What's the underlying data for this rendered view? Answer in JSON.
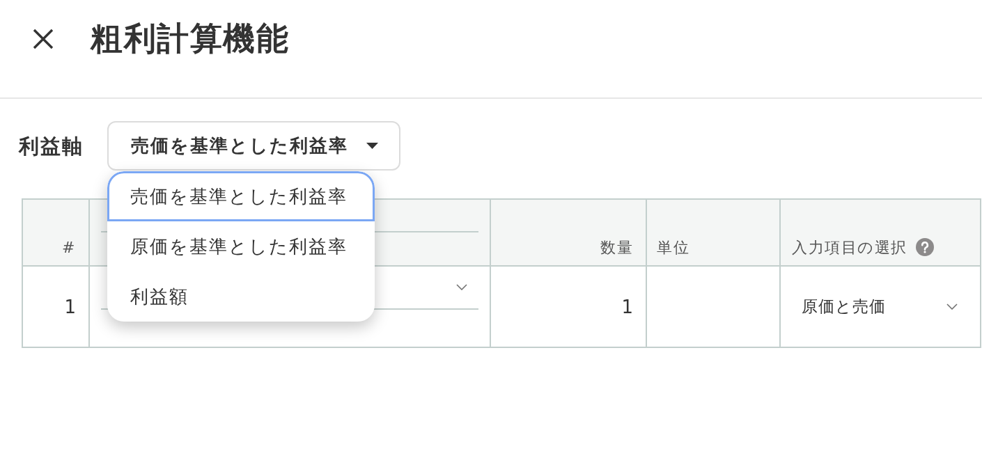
{
  "header": {
    "title": "粗利計算機能"
  },
  "profit_axis": {
    "label": "利益軸",
    "value": "売価を基準とした利益率",
    "expanded": true,
    "options": [
      {
        "label": "売価を基準とした利益率",
        "selected": true
      },
      {
        "label": "原価を基準とした利益率",
        "selected": false
      },
      {
        "label": "利益額",
        "selected": false
      }
    ]
  },
  "table": {
    "columns": [
      {
        "kind": "index",
        "label": "#"
      },
      {
        "kind": "product"
      },
      {
        "kind": "quantity",
        "label": "数量"
      },
      {
        "kind": "unit",
        "label": "単位"
      },
      {
        "kind": "selection",
        "label": "入力項目の選択",
        "help": true
      }
    ],
    "rows": [
      {
        "index": "1",
        "quantity": "1",
        "selection": "原価と売価"
      }
    ]
  }
}
